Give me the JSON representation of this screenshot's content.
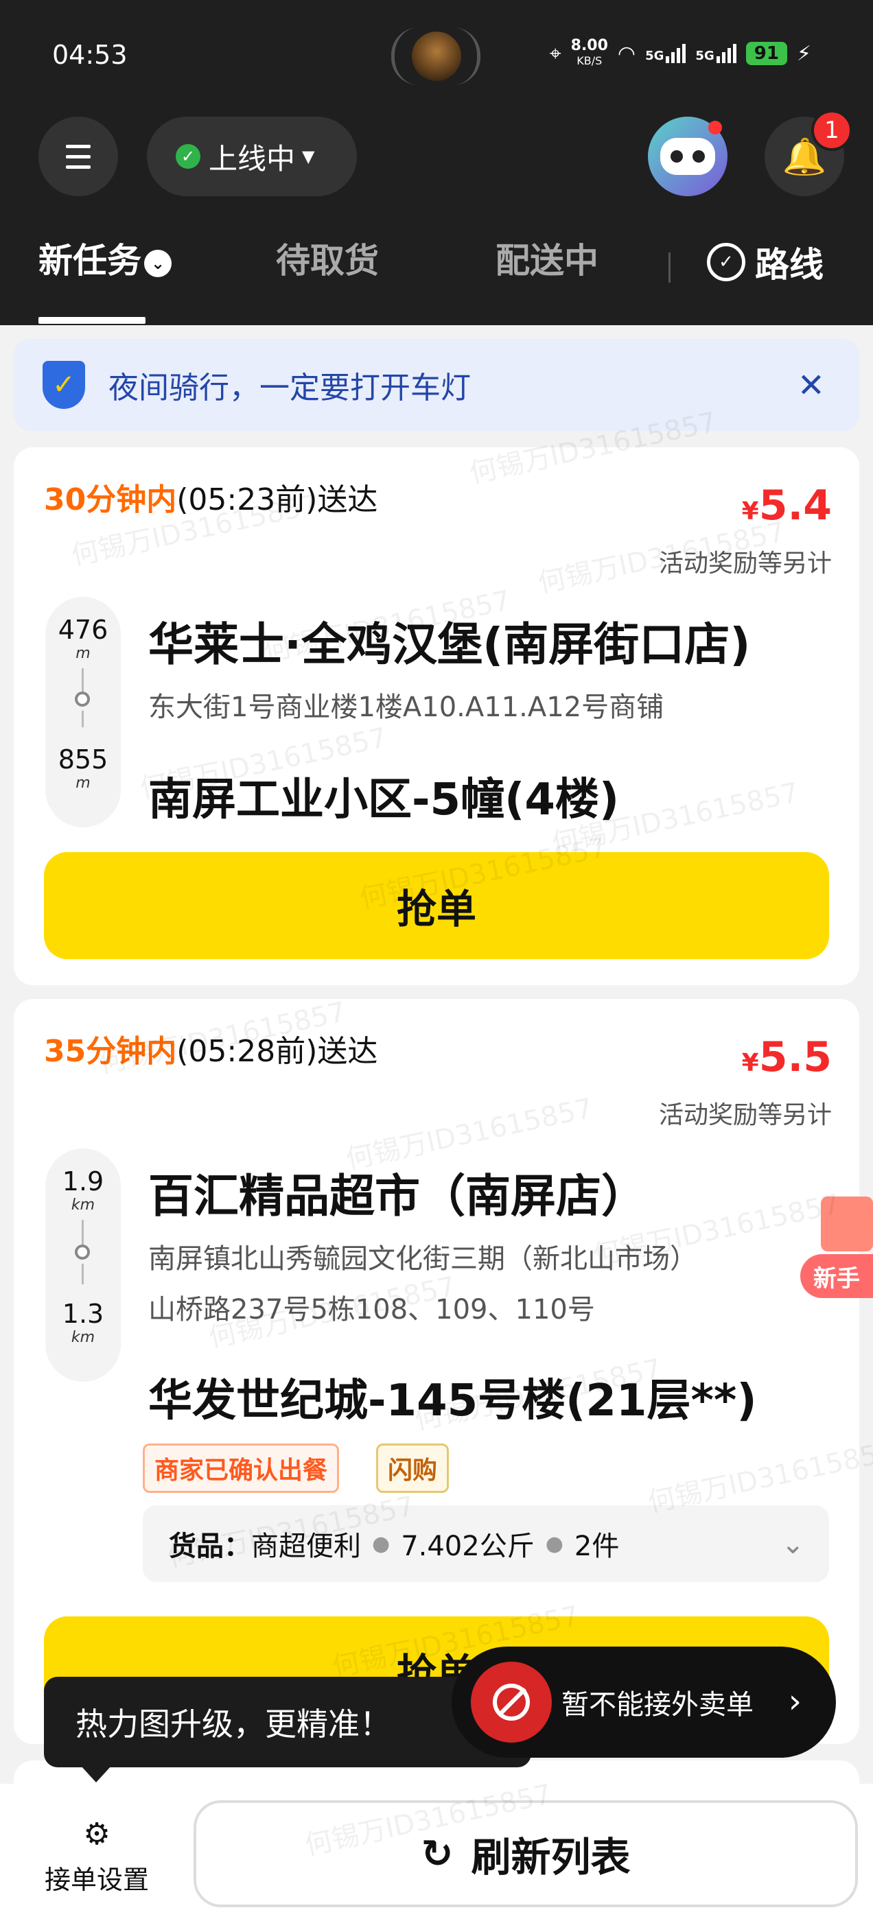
{
  "status_bar": {
    "time": "04:53",
    "speed_value": "8.00",
    "speed_unit": "KB/S",
    "sim1": "5G",
    "sim2": "5G",
    "battery": "91"
  },
  "header": {
    "online_status": "上线中",
    "notification_count": "1"
  },
  "tabs": [
    {
      "label": "新任务",
      "active": true
    },
    {
      "label": "待取货",
      "active": false
    },
    {
      "label": "配送中",
      "active": false
    }
  ],
  "route_label": "路线",
  "notice": {
    "text": "夜间骑行，一定要打开车灯"
  },
  "orders": [
    {
      "eta_highlight": "30分钟内",
      "eta_rest": "(05:23前)送达",
      "price_symbol": "¥",
      "price": "5.4",
      "reward_note": "活动奖励等另计",
      "dist_pickup": "476",
      "dist_pickup_unit": "m",
      "dist_dropoff": "855",
      "dist_dropoff_unit": "m",
      "shop_name": "华莱士·全鸡汉堡(南屏街口店)",
      "shop_address": "东大街1号商业楼1楼A10.A11.A12号商铺",
      "destination": "南屏工业小区-5幢(4楼)",
      "grab_label": "抢单"
    },
    {
      "eta_highlight": "35分钟内",
      "eta_rest": "(05:28前)送达",
      "price_symbol": "¥",
      "price": "5.5",
      "reward_note": "活动奖励等另计",
      "dist_pickup": "1.9",
      "dist_pickup_unit": "km",
      "dist_dropoff": "1.3",
      "dist_dropoff_unit": "km",
      "shop_name": "百汇精品超市（南屏店）",
      "shop_address_line1": "南屏镇北山秀毓园文化街三期（新北山市场）",
      "shop_address_line2": "山桥路237号5栋108、109、110号",
      "destination": "华发世纪城-145号楼(21层**)",
      "tags": [
        "商家已确认出餐",
        "闪购"
      ],
      "goods_label": "货品：",
      "goods_type": "商超便利",
      "goods_weight": "7.402公斤",
      "goods_count": "2件",
      "grab_label": "抢单"
    }
  ],
  "side_badge": "新手",
  "heat_tip": "热力图升级，更精准！",
  "no_takeout": "暂不能接外卖单",
  "bottom": {
    "settings_label": "接单设置",
    "refresh_label": "刷新列表"
  },
  "watermark": "何锡万ID31615857"
}
